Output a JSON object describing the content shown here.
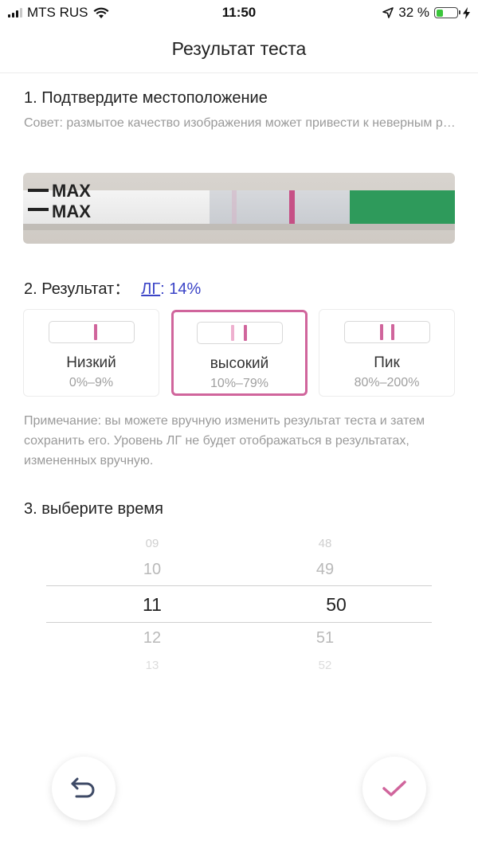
{
  "status_bar": {
    "carrier": "MTS RUS",
    "time": "11:50",
    "battery_percent": "32 %",
    "battery_level": 0.32,
    "icons": [
      "signal-icon",
      "wifi-icon",
      "location-arrow-icon",
      "battery-icon",
      "charging-bolt-icon"
    ]
  },
  "header": {
    "title": "Результат теста"
  },
  "section1": {
    "title": "1. Подтвердите местоположение",
    "hint": "Совет: размытое качество изображения может привести к неверным результатам",
    "strip_labels": [
      "MAX",
      "MAX"
    ]
  },
  "section2": {
    "title": "2. Результат：",
    "lg_label": "ЛГ",
    "lg_value": ": 14%",
    "options": [
      {
        "name": "Низкий",
        "range": "0%–9%",
        "selected": false
      },
      {
        "name": "высокий",
        "range": "10%–79%",
        "selected": true
      },
      {
        "name": "Пик",
        "range": "80%–200%",
        "selected": false
      }
    ],
    "note": "Примечание: вы можете вручную изменить результат теста и затем сохранить его. Уровень ЛГ не будет отображаться в результатах, измененных вручную."
  },
  "section3": {
    "title": "3. выберите время",
    "hours": [
      "09",
      "10",
      "11",
      "12",
      "13"
    ],
    "minutes": [
      "48",
      "49",
      "50",
      "51",
      "52"
    ],
    "selected_hour": "11",
    "selected_minute": "50"
  },
  "colors": {
    "accent_pink": "#d0659c",
    "link_blue": "#3b44c7",
    "strip_green": "#2e9a5b"
  },
  "buttons": {
    "back_icon": "undo-arrow-icon",
    "confirm_icon": "checkmark-icon"
  }
}
